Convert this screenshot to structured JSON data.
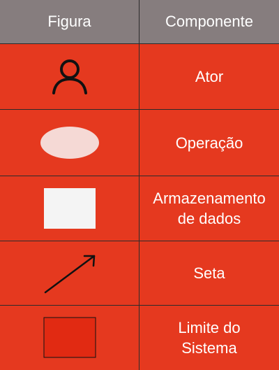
{
  "headers": {
    "figura": "Figura",
    "componente": "Componente"
  },
  "rows": [
    {
      "icon": "actor-icon",
      "label": "Ator"
    },
    {
      "icon": "ellipse-icon",
      "label": "Operação"
    },
    {
      "icon": "rectangle-icon",
      "label": "Armazenamento\nde dados"
    },
    {
      "icon": "arrow-icon",
      "label": "Seta"
    },
    {
      "icon": "system-boundary-icon",
      "label": "Limite do\nSistema"
    }
  ],
  "colors": {
    "header_background": "#867d7e",
    "row_background": "#e5391f",
    "text": "#ffffff",
    "grid_line": "#2b2b2b",
    "ellipse_fill": "#f5d9d5",
    "store_fill": "#f4f4f4",
    "boundary_fill": "#e12a12",
    "stroke": "#111111"
  }
}
